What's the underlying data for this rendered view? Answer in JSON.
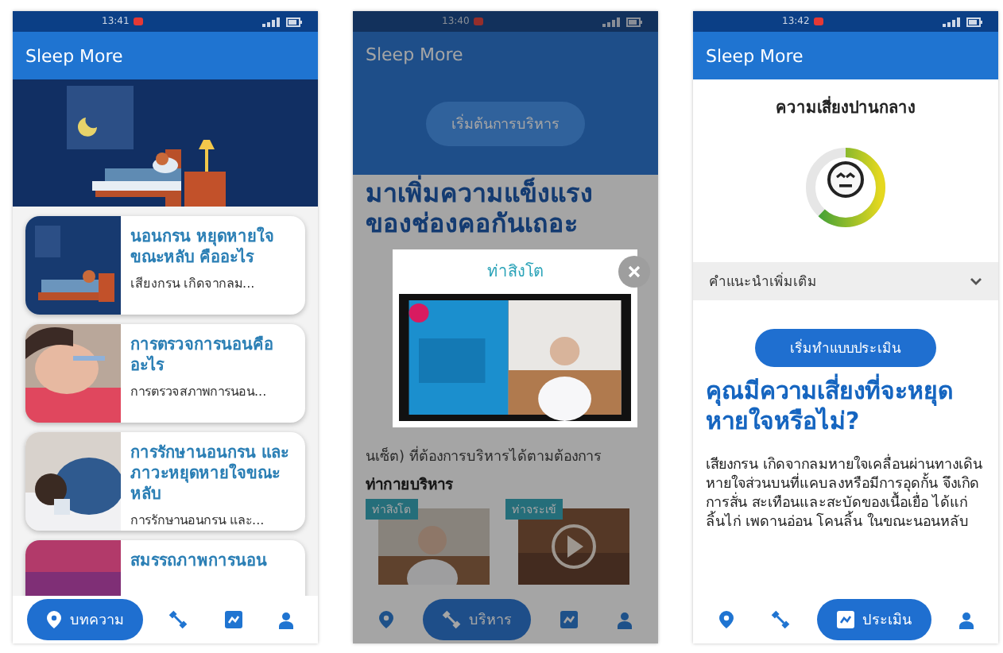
{
  "screens": [
    {
      "kind": "articles",
      "status_time": "13:41",
      "app_title": "Sleep More",
      "articles": [
        {
          "title": "นอนกรน หยุดหายใจขณะหลับ คืออะไร",
          "excerpt": "เสียงกรน เกิดจากลม..."
        },
        {
          "title": "การตรวจการนอนคืออะไร",
          "excerpt": "การตรวจสภาพการนอน..."
        },
        {
          "title": "การรักษานอนกรน และภาวะหยุดหายใจขณะหลับ",
          "excerpt": "การรักษานอนกรน และ..."
        },
        {
          "title": "สมรรถภาพการนอน"
        }
      ],
      "nav": [
        {
          "label": "บทความ",
          "selected": true
        },
        {
          "selected": false
        },
        {
          "selected": false
        },
        {
          "selected": false
        }
      ]
    },
    {
      "kind": "exercise",
      "status_time": "13:40",
      "app_title": "Sleep More",
      "start_button": "เริ่มต้นการบริหาร",
      "heading": "มาเพิ่มความแข็งแรงของช่องคอกันเถอะ",
      "body_lines": [
        "นเซ็ต) ที่ต้องการบริหารได้ตามต้องการ"
      ],
      "section_title": "ท่ากายบริหาร",
      "thumbnails": [
        {
          "label": "ท่าสิงโต"
        },
        {
          "label": "ท่าจระเข้"
        }
      ],
      "modal": {
        "title": "ท่าสิงโต"
      },
      "nav": [
        {
          "selected": false
        },
        {
          "label": "บริหาร",
          "selected": true
        },
        {
          "selected": false
        },
        {
          "selected": false
        }
      ]
    },
    {
      "kind": "assessment",
      "status_time": "13:42",
      "app_title": "Sleep More",
      "risk_label": "ความเสี่ยงปานกลาง",
      "gauge": {
        "level": 0.62
      },
      "accordion": {
        "label": "คำแนะนำเพิ่มเติม",
        "expanded": false
      },
      "start_button": "เริ่มทำแบบประเมิน",
      "heading": "คุณมีความเสี่ยงที่จะหยุดหายใจหรือไม่?",
      "body": "เสียงกรน เกิดจากลมหายใจเคลื่อนผ่านทางเดินหายใจส่วนบนที่แคบลงหรือมีการอุดกั้น จึงเกิดการสั่น สะเทือนและสะบัดของเนื้อเยื่อ ได้แก่ ลิ้นไก่ เพดานอ่อน โคนลิ้น ในขณะนอนหลับ",
      "nav": [
        {
          "selected": false
        },
        {
          "selected": false
        },
        {
          "label": "ประเมิน",
          "selected": true
        },
        {
          "selected": false
        }
      ]
    }
  ]
}
